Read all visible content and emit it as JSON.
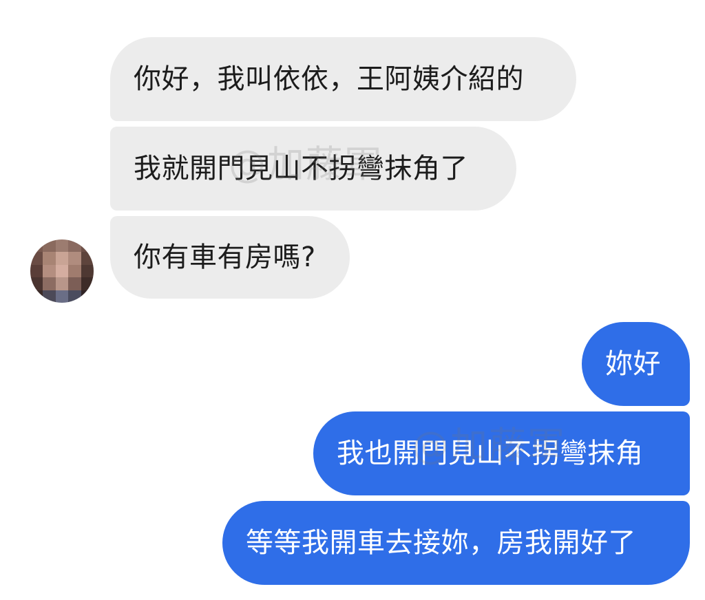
{
  "conversation": {
    "incoming": [
      {
        "text": "你好，我叫依依，王阿姨介紹的"
      },
      {
        "text": "我就開門見山不拐彎抹角了"
      },
      {
        "text": "你有車有房嗎?"
      }
    ],
    "outgoing": [
      {
        "text": "妳好"
      },
      {
        "text": "我也開門見山不拐彎抹角"
      },
      {
        "text": "等等我開車去接妳，房我開好了"
      }
    ]
  },
  "watermark": {
    "text": "@加藤軍"
  },
  "colors": {
    "incoming_bubble": "#ececec",
    "outgoing_bubble": "#2f6ee8",
    "incoming_text": "#1c1c1c",
    "outgoing_text": "#ffffff"
  },
  "avatar": {
    "icon": "pixelated-avatar-icon",
    "pixels": [
      "#7a5a50",
      "#8a6a5e",
      "#9c7c70",
      "#8a6a60",
      "#6e5048",
      "#6a4c44",
      "#a88474",
      "#c9a495",
      "#b08c7e",
      "#5e443c",
      "#5a3e38",
      "#b48e80",
      "#d4ada0",
      "#a07c6e",
      "#4e3832",
      "#4a3430",
      "#8c6c62",
      "#b8968a",
      "#7c5e56",
      "#3e2c28",
      "#3a2a28",
      "#4c4a58",
      "#6a6e86",
      "#4a4c5e",
      "#302426"
    ]
  }
}
